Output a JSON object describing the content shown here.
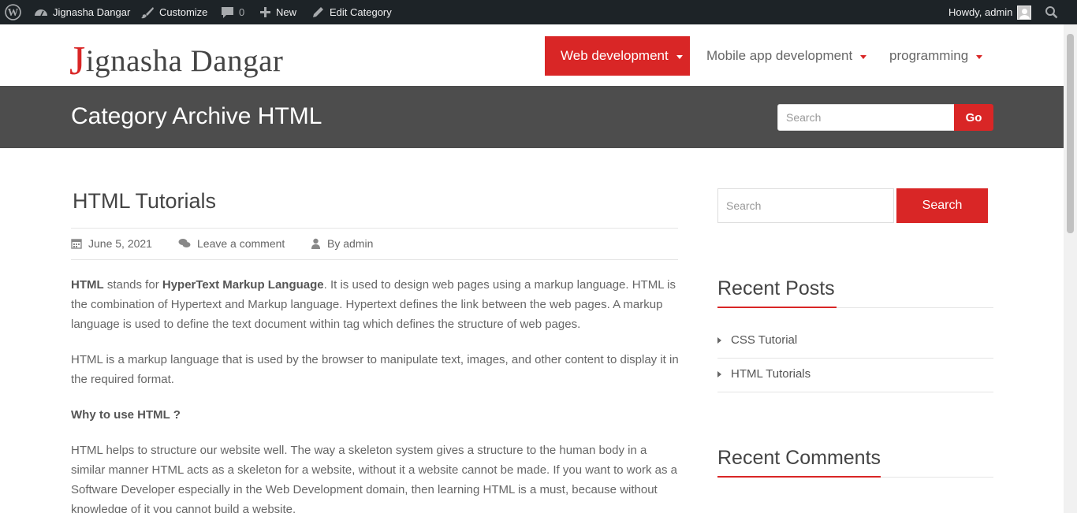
{
  "admin_bar": {
    "site_name": "Jignasha Dangar",
    "customize": "Customize",
    "comments_count": "0",
    "new_label": "New",
    "edit_category": "Edit Category",
    "howdy": "Howdy, admin"
  },
  "header": {
    "logo_first": "J",
    "logo_rest": "ignasha Dangar",
    "nav": [
      {
        "label": "Web development",
        "active": true
      },
      {
        "label": "Mobile app development",
        "active": false
      },
      {
        "label": "programming",
        "active": false
      }
    ]
  },
  "band": {
    "title": "Category Archive HTML",
    "search_placeholder": "Search",
    "go_label": "Go"
  },
  "post": {
    "title": "HTML Tutorials",
    "date": "June 5, 2021",
    "comment_link": "Leave a comment",
    "author": "By admin",
    "p1_b1": "HTML",
    "p1_t1": " stands for ",
    "p1_b2": "HyperText Markup Language",
    "p1_t2": ". It is used to design web pages using a markup language. HTML is the combination of Hypertext and Markup language. Hypertext defines the link between the web pages. A markup language is used to define the text document within tag which defines the structure of web pages.",
    "p2": "HTML is a markup language that is used by the browser to manipulate text, images, and other content to display it in the required format.",
    "p3_heading": "Why to use HTML ?",
    "p4": "HTML helps to structure our website well. The way a skeleton system gives a structure to the human body in a similar manner HTML acts as a skeleton for a website, without it a website cannot be made. If you want to work as a Software Developer especially in the Web Development domain, then learning HTML is a must, because without knowledge of it you cannot build a website."
  },
  "sidebar": {
    "search_placeholder": "Search",
    "search_button": "Search",
    "recent_posts_title": "Recent Posts",
    "recent_posts": [
      "CSS Tutorial",
      "HTML Tutorials"
    ],
    "recent_comments_title": "Recent Comments"
  },
  "colors": {
    "accent": "#d92626",
    "admin_bar": "#1d2327",
    "band": "#4d4d4d"
  }
}
